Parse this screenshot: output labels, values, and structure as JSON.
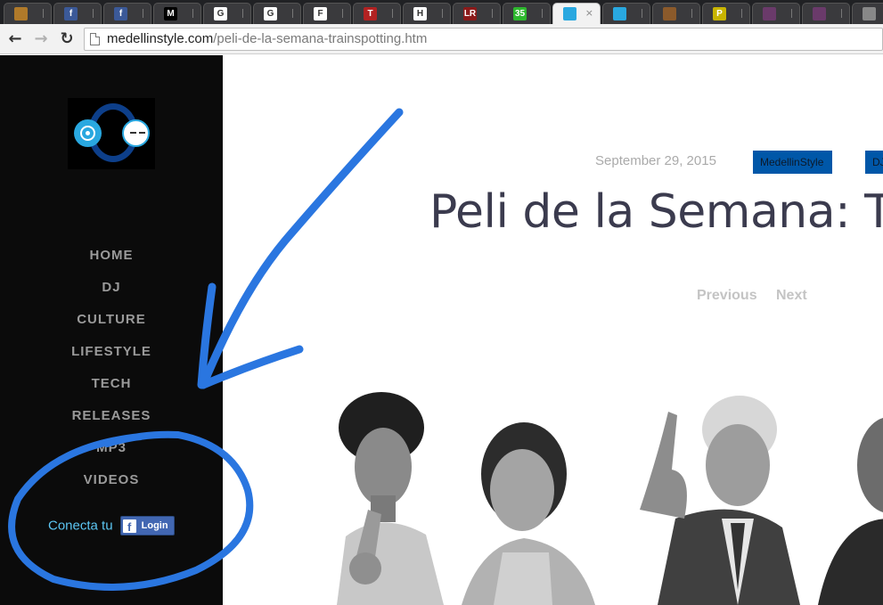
{
  "browser": {
    "tabs": [
      {
        "icon": "box-icon",
        "color": "#b07a2a",
        "glyph": ""
      },
      {
        "icon": "facebook-icon",
        "color": "#3b5998",
        "glyph": "f"
      },
      {
        "icon": "facebook-notification-icon",
        "color": "#3b5998",
        "glyph": "f"
      },
      {
        "icon": "medium-m-icon",
        "color": "#000000",
        "glyph": "M"
      },
      {
        "icon": "google-icon",
        "color": "#ffffff",
        "glyph": "G"
      },
      {
        "icon": "google-icon",
        "color": "#ffffff",
        "glyph": "G"
      },
      {
        "icon": "f-letter-icon",
        "color": "#ffffff",
        "glyph": "F"
      },
      {
        "icon": "t-letter-icon",
        "color": "#b22222",
        "glyph": "T"
      },
      {
        "icon": "h-letter-icon",
        "color": "#ffffff",
        "glyph": "H"
      },
      {
        "icon": "lr-icon",
        "color": "#8b1a1a",
        "glyph": "LR"
      },
      {
        "icon": "badge-35-icon",
        "color": "#2eb82e",
        "glyph": "35"
      },
      {
        "icon": "medellinstyle-icon",
        "color": "#29a8e0",
        "glyph": ""
      },
      {
        "icon": "medellinstyle-icon",
        "color": "#29a8e0",
        "glyph": ""
      },
      {
        "icon": "image-thumb-icon",
        "color": "#8b5a2b",
        "glyph": ""
      },
      {
        "icon": "p-letter-icon",
        "color": "#c8b400",
        "glyph": "P"
      },
      {
        "icon": "swirl-icon",
        "color": "#6a3a6a",
        "glyph": ""
      },
      {
        "icon": "swirl-icon",
        "color": "#6a3a6a",
        "glyph": ""
      },
      {
        "icon": "globe-icon",
        "color": "#888888",
        "glyph": ""
      }
    ],
    "active_tab_index": 11,
    "close_glyph": "×",
    "url_host": "medellinstyle.com",
    "url_path": "/peli-de-la-semana-trainspotting.htm"
  },
  "sidebar": {
    "menu": [
      "HOME",
      "DJ",
      "CULTURE",
      "LIFESTYLE",
      "TECH",
      "RELEASES",
      "MP3",
      "VIDEOS"
    ],
    "fb_label": "Conecta tu",
    "fb_button": "Login"
  },
  "post": {
    "date": "September 29, 2015",
    "tags": [
      "MedellinStyle",
      "DJ"
    ],
    "title": "Peli de la Semana: Trainspotting",
    "previous": "Previous",
    "next": "Next"
  },
  "colors": {
    "accent_blue": "#0057a8",
    "annotation_blue": "#2a76e0",
    "fb_blue": "#4267b2",
    "link_cyan": "#5cc6f3"
  }
}
